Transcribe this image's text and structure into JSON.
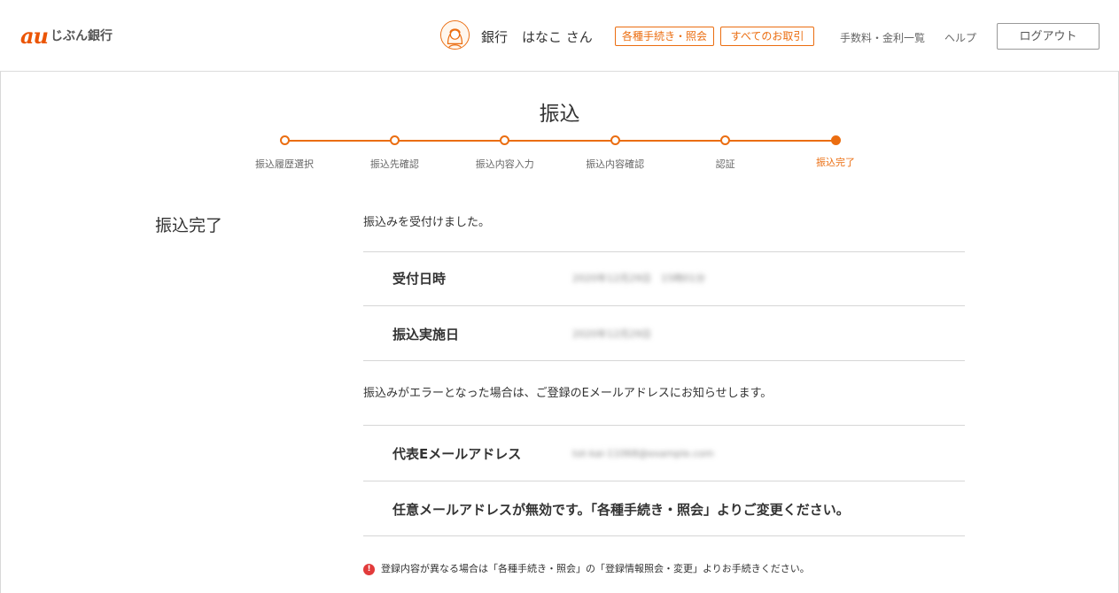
{
  "colors": {
    "accent": "#eb6d10",
    "brand": "#eb5505",
    "error": "#e23b3b"
  },
  "header": {
    "logo_au": "au",
    "logo_text": "じぶん銀行",
    "avatar_icon": "user-avatar-icon",
    "user_bank": "銀行",
    "user_name": "はなこ さん",
    "btn_procedures": "各種手続き・照会",
    "btn_transactions": "すべてのお取引",
    "link_fees": "手数料・金利一覧",
    "link_help": "ヘルプ",
    "btn_logout": "ログアウト"
  },
  "page": {
    "title": "振込"
  },
  "stepper": {
    "steps": [
      {
        "label": "振込履歴選択"
      },
      {
        "label": "振込先確認"
      },
      {
        "label": "振込内容入力"
      },
      {
        "label": "振込内容確認"
      },
      {
        "label": "認証"
      },
      {
        "label": "振込完了"
      }
    ],
    "current_step": 6
  },
  "content": {
    "section_title": "振込完了",
    "received_message": "振込みを受付けました。",
    "rows": [
      {
        "label": "受付日時",
        "value": "2020年12月29日　15時01分"
      },
      {
        "label": "振込実施日",
        "value": "2020年12月29日"
      }
    ],
    "error_message": "振込みがエラーとなった場合は、ご登録のEメールアドレスにお知らせします。",
    "email_row": {
      "label": "代表Eメールアドレス",
      "value": "tot-kai-11068@example.com"
    },
    "optional_email_notice": "任意メールアドレスが無効です。「各種手続き・照会」よりご変更ください。",
    "footer_notice_icon": "exclamation-icon",
    "footer_notice": "登録内容が異なる場合は「各種手続き・照会」の「登録情報照会・変更」よりお手続きください。",
    "footer_notice_mark": "!"
  }
}
